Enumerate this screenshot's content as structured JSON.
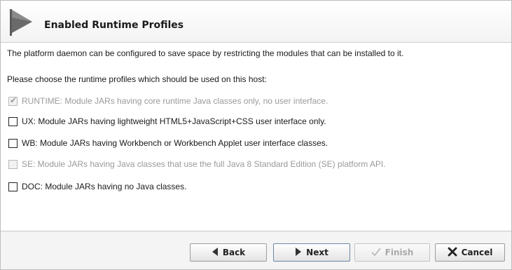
{
  "header": {
    "title": "Enabled Runtime Profiles",
    "icon": "flag-icon"
  },
  "content": {
    "description": "The platform daemon can be configured to save space by restricting the modules that can be installed to it.",
    "prompt": "Please choose the runtime profiles which should be used on this host:",
    "options": [
      {
        "label": "RUNTIME: Module JARs having core runtime Java classes only, no user interface.",
        "checked": true,
        "enabled": false
      },
      {
        "label": "UX: Module JARs having lightweight HTML5+JavaScript+CSS user interface only.",
        "checked": false,
        "enabled": true
      },
      {
        "label": "WB: Module JARs having Workbench or Workbench Applet user interface classes.",
        "checked": false,
        "enabled": true
      },
      {
        "label": "SE: Module JARs having Java classes that use the full Java 8 Standard Edition (SE) platform API.",
        "checked": false,
        "enabled": false
      },
      {
        "label": "DOC: Module JARs having no Java classes.",
        "checked": false,
        "enabled": true
      }
    ]
  },
  "footer": {
    "back_label": "Back",
    "next_label": "Next",
    "finish_label": "Finish",
    "cancel_label": "Cancel"
  },
  "colors": {
    "disabled_text": "#9a9a9a",
    "cancel_x": "#222222"
  }
}
